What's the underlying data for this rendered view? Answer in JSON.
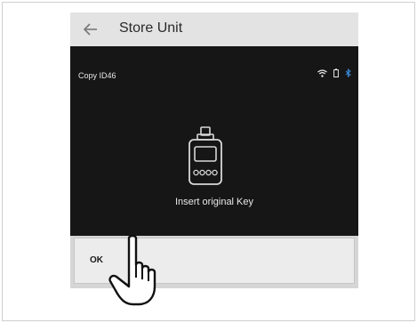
{
  "appbar": {
    "title": "Store Unit",
    "back_icon": "arrow-left-icon"
  },
  "screen": {
    "status_text": "Copy ID46",
    "icons": [
      "wifi-icon",
      "battery-icon",
      "bluetooth-icon"
    ],
    "key_icon": "key-fob-icon",
    "prompt": "Insert original Key"
  },
  "actions": {
    "ok_label": "OK"
  },
  "colors": {
    "appbar_bg": "#e3e3e3",
    "screen_bg": "#161616",
    "bluetooth": "#3b8fe0"
  }
}
